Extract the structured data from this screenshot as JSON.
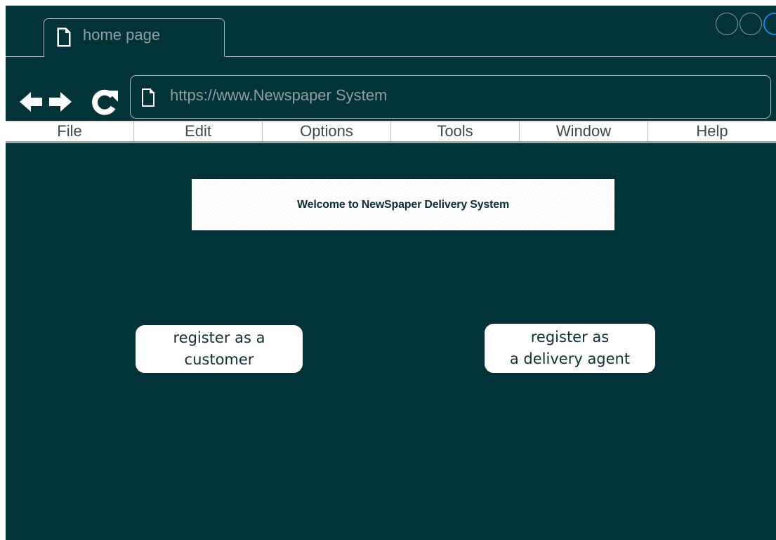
{
  "browser": {
    "tab_title": "home page",
    "address": "https://www.Newspaper System",
    "nav_icons": [
      "back-arrow-icon",
      "forward-arrow-icon",
      "reload-icon"
    ],
    "window_controls": [
      "minimize-circle",
      "maximize-circle",
      "close-circle"
    ]
  },
  "menu": {
    "items": [
      "File",
      "Edit",
      "Options",
      "Tools",
      "Window",
      "Help"
    ]
  },
  "page": {
    "welcome": "Welcome to NewSpaper Delivery System",
    "register_customer": "register as a\ncustomer",
    "register_agent": "register as\na delivery agent"
  },
  "colors": {
    "background": "#013338",
    "foreground_light": "#ffffff",
    "text_dark": "#0e2f33",
    "close_control": "#1b86e0"
  }
}
